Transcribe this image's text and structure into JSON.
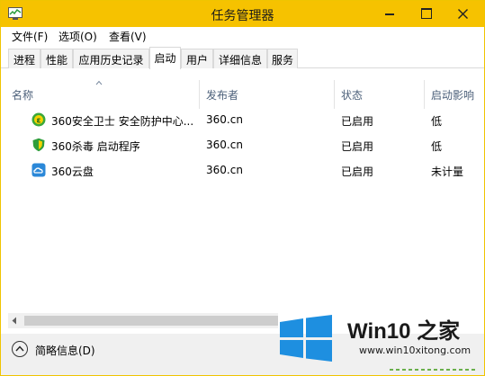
{
  "window": {
    "title": "任务管理器",
    "accent_color": "#f6c200"
  },
  "menu": [
    {
      "label": "文件(F)"
    },
    {
      "label": "选项(O)"
    },
    {
      "label": "查看(V)"
    }
  ],
  "tabs": [
    {
      "label": "进程",
      "active": false
    },
    {
      "label": "性能",
      "active": false
    },
    {
      "label": "应用历史记录",
      "active": false
    },
    {
      "label": "启动",
      "active": true
    },
    {
      "label": "用户",
      "active": false
    },
    {
      "label": "详细信息",
      "active": false
    },
    {
      "label": "服务",
      "active": false
    }
  ],
  "table": {
    "columns": [
      "名称",
      "发布者",
      "状态",
      "启动影响"
    ],
    "rows": [
      {
        "icon": "360-safeguard-icon",
        "name": "360安全卫士 安全防护中心...",
        "publisher": "360.cn",
        "status": "已启用",
        "impact": "低"
      },
      {
        "icon": "360-antivirus-shield-icon",
        "name": "360杀毒 启动程序",
        "publisher": "360.cn",
        "status": "已启用",
        "impact": "低"
      },
      {
        "icon": "360-cloud-drive-icon",
        "name": "360云盘",
        "publisher": "360.cn",
        "status": "已启用",
        "impact": "未计量"
      }
    ]
  },
  "footer": {
    "collapse_label": "简略信息(D)"
  },
  "watermark": {
    "brand": "Win10 之家",
    "url": "www.win10xitong.com",
    "logo_color": "#1e8fe0"
  }
}
